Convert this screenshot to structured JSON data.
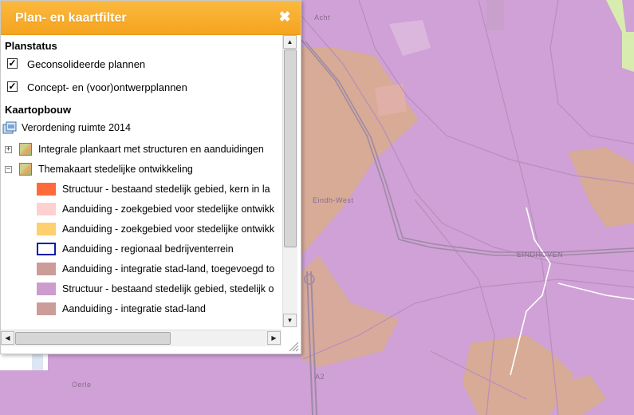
{
  "panel": {
    "title": "Plan- en kaartfilter",
    "close_symbol": "✖",
    "planstatus": {
      "heading": "Planstatus",
      "items": [
        {
          "label": "Geconsolideerde plannen",
          "checked": true
        },
        {
          "label": "Concept- en (voor)ontwerpplannen",
          "checked": true
        }
      ]
    },
    "kaartopbouw": {
      "heading": "Kaartopbouw",
      "root_label": "Verordening ruimte 2014",
      "root_icon": "map-service-icon",
      "layers": [
        {
          "label": "Integrale plankaart met structuren en aanduidingen",
          "expander": "+",
          "icon": "layer-map-icon"
        },
        {
          "label": "Themakaart stedelijke ontwikkeling",
          "expander": "−",
          "icon": "layer-map-icon"
        }
      ],
      "legend": [
        {
          "label": "Structuur - bestaand stedelijk gebied, kern in la",
          "fill": "#ff6a3c",
          "border": "#ff6a3c"
        },
        {
          "label": "Aanduiding - zoekgebied voor stedelijke ontwikk",
          "fill": "#ffd0d0",
          "border": "#ffd0d0"
        },
        {
          "label": "Aanduiding - zoekgebied voor stedelijke ontwikk",
          "fill": "#ffd070",
          "border": "#ffd070"
        },
        {
          "label": "Aanduiding - regionaal bedrijventerrein",
          "fill": "#ffffff",
          "border": "#0a1ea8"
        },
        {
          "label": "Aanduiding - integratie stad-land, toegevoegd to",
          "fill": "#cc9c98",
          "border": "#cc9c98"
        },
        {
          "label": "Structuur - bestaand stedelijk gebied, stedelijk o",
          "fill": "#cc9ccf",
          "border": "#cc9ccf"
        },
        {
          "label": "Aanduiding - integratie stad-land",
          "fill": "#cc9c98",
          "border": "#cc9c98"
        }
      ]
    },
    "scroll": {
      "vertical_fraction": 0.75,
      "horizontal_fraction": 0.62
    }
  },
  "map": {
    "labels": {
      "acht": "Acht",
      "eindh_west": "Eindh-West",
      "eindhoven": "EINDHOVEN",
      "oerle": "Oerle",
      "a2": "A2"
    },
    "colors": {
      "urban": "#cfa1d6",
      "integration": "#d7ab96",
      "search_zone": "#f2c7b8",
      "green": "#d8ecb0"
    }
  }
}
